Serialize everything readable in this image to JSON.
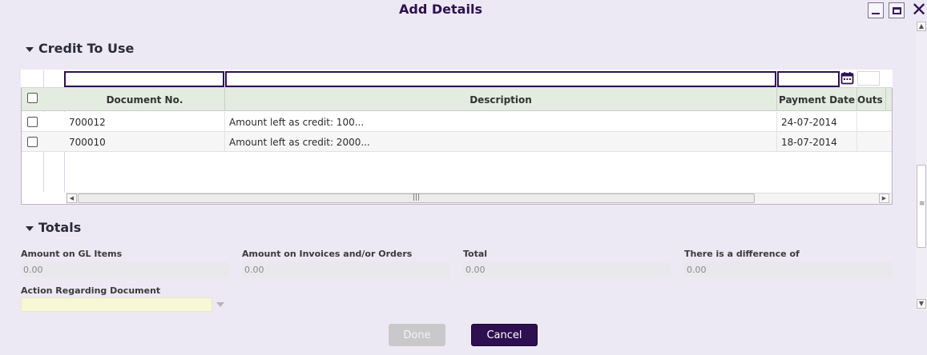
{
  "window": {
    "title": "Add Details",
    "minimize_icon": "minimize-icon",
    "maximize_icon": "maximize-icon",
    "close_icon": "close-icon",
    "close_glyph": "✕"
  },
  "credit_section": {
    "title": "Credit To Use",
    "columns": [
      "Document No.",
      "Description",
      "Payment Date",
      "Outs"
    ],
    "rows": [
      {
        "document_no": "700012",
        "description": "Amount left as credit: 100...",
        "payment_date": "24-07-2014"
      },
      {
        "document_no": "700010",
        "description": "Amount left as credit: 2000...",
        "payment_date": "18-07-2014"
      }
    ],
    "filter_values": {
      "document_no": "",
      "description": "",
      "payment_date": ""
    }
  },
  "totals_section": {
    "title": "Totals",
    "fields": [
      {
        "label": "Amount on GL Items",
        "value": "0.00"
      },
      {
        "label": "Amount on Invoices and/or Orders",
        "value": "0.00"
      },
      {
        "label": "Total",
        "value": "0.00"
      },
      {
        "label": "There is a difference of",
        "value": "0.00"
      }
    ],
    "action_label": "Action Regarding Document",
    "action_value": ""
  },
  "buttons": {
    "done": "Done",
    "cancel": "Cancel"
  },
  "colors": {
    "accent": "#2e0f50",
    "header_bg": "#e4ebe0",
    "background": "#ece9f4"
  }
}
